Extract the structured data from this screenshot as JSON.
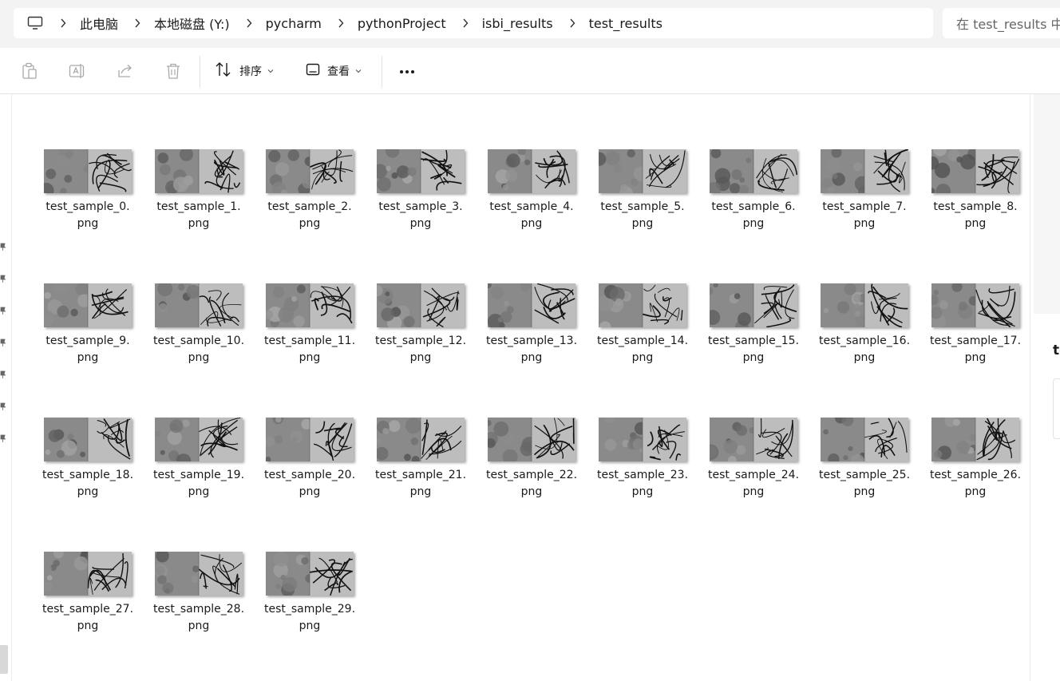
{
  "address_bar": {
    "root_icon": "computer-icon",
    "crumbs": [
      "此电脑",
      "本地磁盘 (Y:)",
      "pycharm",
      "pythonProject",
      "isbi_results",
      "test_results"
    ]
  },
  "search": {
    "placeholder": "在 test_results 中"
  },
  "toolbar": {
    "icons": [
      "copy-icon",
      "rename-icon",
      "share-icon",
      "delete-icon"
    ],
    "sort_label": "排序",
    "view_label": "查看",
    "more_icon": "more-icon"
  },
  "files": [
    {
      "l1": "test_sample_0.",
      "l2": "png"
    },
    {
      "l1": "test_sample_1.",
      "l2": "png"
    },
    {
      "l1": "test_sample_2.",
      "l2": "png"
    },
    {
      "l1": "test_sample_3.",
      "l2": "png"
    },
    {
      "l1": "test_sample_4.",
      "l2": "png"
    },
    {
      "l1": "test_sample_5.",
      "l2": "png"
    },
    {
      "l1": "test_sample_6.",
      "l2": "png"
    },
    {
      "l1": "test_sample_7.",
      "l2": "png"
    },
    {
      "l1": "test_sample_8.",
      "l2": "png"
    },
    {
      "l1": "test_sample_9.",
      "l2": "png"
    },
    {
      "l1": "test_sample_10.",
      "l2": "png"
    },
    {
      "l1": "test_sample_11.",
      "l2": "png"
    },
    {
      "l1": "test_sample_12.",
      "l2": "png"
    },
    {
      "l1": "test_sample_13.",
      "l2": "png"
    },
    {
      "l1": "test_sample_14.",
      "l2": "png"
    },
    {
      "l1": "test_sample_15.",
      "l2": "png"
    },
    {
      "l1": "test_sample_16.",
      "l2": "png"
    },
    {
      "l1": "test_sample_17.",
      "l2": "png"
    },
    {
      "l1": "test_sample_18.",
      "l2": "png"
    },
    {
      "l1": "test_sample_19.",
      "l2": "png"
    },
    {
      "l1": "test_sample_20.",
      "l2": "png"
    },
    {
      "l1": "test_sample_21.",
      "l2": "png"
    },
    {
      "l1": "test_sample_22.",
      "l2": "png"
    },
    {
      "l1": "test_sample_23.",
      "l2": "png"
    },
    {
      "l1": "test_sample_24.",
      "l2": "png"
    },
    {
      "l1": "test_sample_25.",
      "l2": "png"
    },
    {
      "l1": "test_sample_26.",
      "l2": "png"
    },
    {
      "l1": "test_sample_27.",
      "l2": "png"
    },
    {
      "l1": "test_sample_28.",
      "l2": "png"
    },
    {
      "l1": "test_sample_29.",
      "l2": "png"
    }
  ],
  "details_pane": {
    "title": "test_results"
  }
}
